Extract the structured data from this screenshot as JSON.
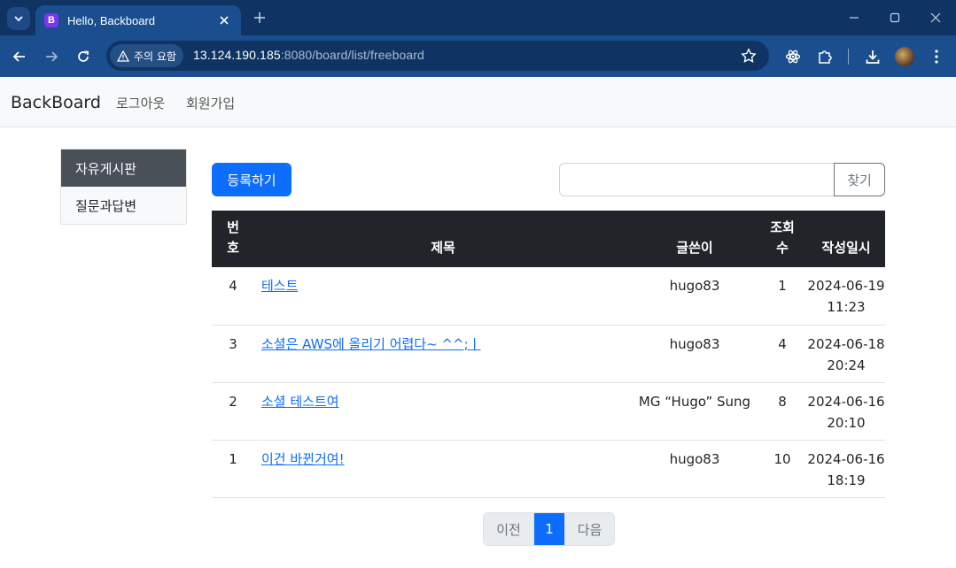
{
  "browser": {
    "tab_title": "Hello, Backboard",
    "favicon_letter": "B",
    "security_chip": "주의 요함",
    "url_host": "13.124.190.185",
    "url_rest": ":8080/board/list/freeboard"
  },
  "navbar": {
    "brand": "BackBoard",
    "links": [
      "로그아웃",
      "회원가입"
    ]
  },
  "sidebar": {
    "items": [
      {
        "label": "자유게시판",
        "active": true
      },
      {
        "label": "질문과답변",
        "active": false
      }
    ]
  },
  "actions": {
    "create_label": "등록하기",
    "search_placeholder": "",
    "search_button": "찾기"
  },
  "table": {
    "headers": {
      "num": [
        "번",
        "호"
      ],
      "subject": "제목",
      "author": "글쓴이",
      "views": [
        "조회",
        "수"
      ],
      "date": "작성일시"
    },
    "rows": [
      {
        "num": "4",
        "subject": "테스트",
        "author": "hugo83",
        "views": "1",
        "date": "2024-06-19",
        "time": "11:23"
      },
      {
        "num": "3",
        "subject": "소셜은 AWS에 올리기 어렵다~ ^^;ㅣ",
        "author": "hugo83",
        "views": "4",
        "date": "2024-06-18",
        "time": "20:24"
      },
      {
        "num": "2",
        "subject": "소셜 테스트여",
        "author": "MG “Hugo” Sung",
        "views": "8",
        "date": "2024-06-16",
        "time": "20:10"
      },
      {
        "num": "1",
        "subject": "이건 바뀐거여!",
        "author": "hugo83",
        "views": "10",
        "date": "2024-06-16",
        "time": "18:19"
      }
    ]
  },
  "pagination": {
    "prev": "이전",
    "current": "1",
    "next": "다음"
  },
  "colors": {
    "primary": "#0d6efd",
    "chrome_dark": "#0f3463",
    "chrome_toolbar": "#1a4e8f",
    "table_header": "#212529",
    "sidebar_active": "#495057"
  }
}
